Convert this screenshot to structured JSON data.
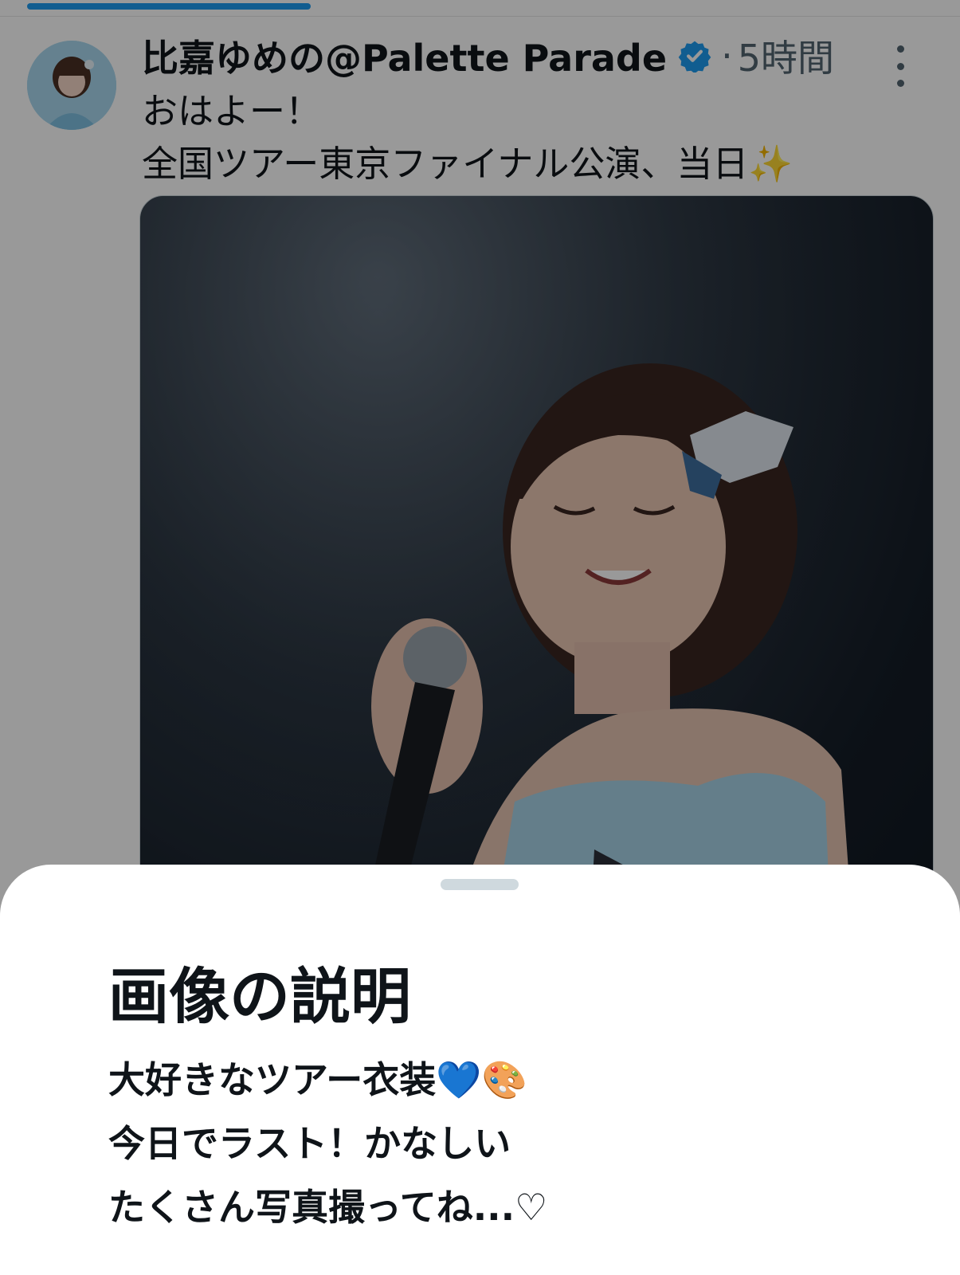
{
  "tweet": {
    "display_name": "比嘉ゆめの@Palette Parade",
    "time_separator": "·",
    "time": "5時間",
    "text_line1": "おはよー！",
    "text_line2": "全国ツアー東京ファイナル公演、当日",
    "text_emoji": "✨"
  },
  "alt_sheet": {
    "title": "画像の説明",
    "description_line1": "大好きなツアー衣装💙🎨",
    "description_line2": "今日でラスト！かなしい",
    "description_line3": "たくさん写真撮ってね...♡"
  },
  "colors": {
    "accent": "#1d9bf0",
    "text_primary": "#0f1419",
    "text_secondary": "#536471",
    "scrim": "rgba(0,0,0,0.40)"
  },
  "icons": {
    "verified": "verified-badge-icon",
    "more": "more-vertical-icon"
  }
}
